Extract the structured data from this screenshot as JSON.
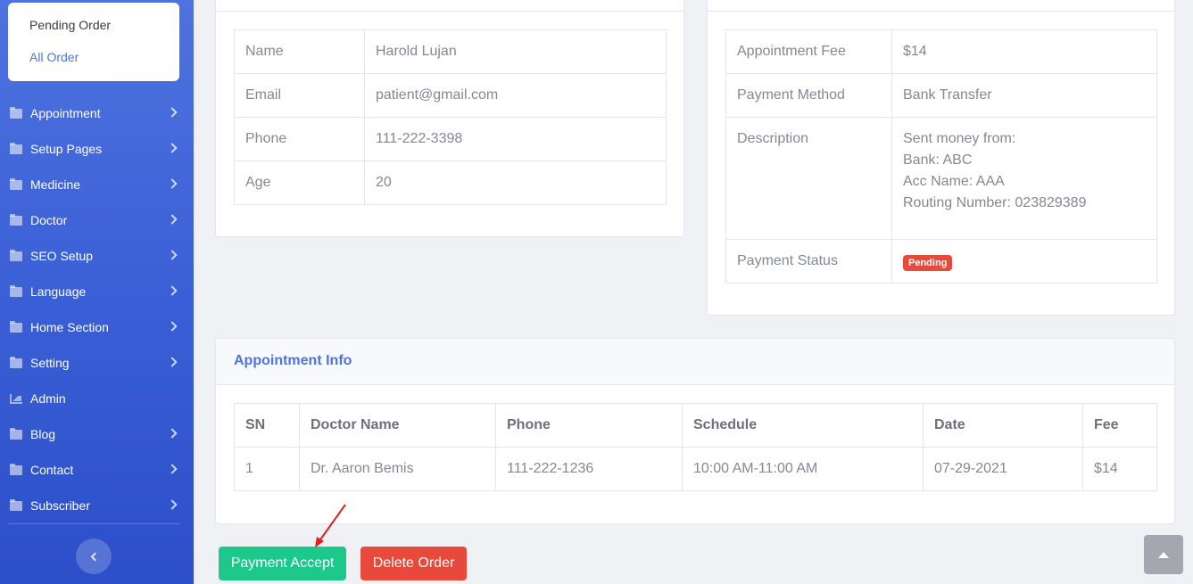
{
  "sidebar": {
    "submenu": [
      "Pending Order",
      "All Order"
    ],
    "items": [
      {
        "label": "Appointment",
        "icon": "folder-icon",
        "chevron": true
      },
      {
        "label": "Setup Pages",
        "icon": "folder-icon",
        "chevron": true
      },
      {
        "label": "Medicine",
        "icon": "folder-icon",
        "chevron": true
      },
      {
        "label": "Doctor",
        "icon": "folder-icon",
        "chevron": true
      },
      {
        "label": "SEO Setup",
        "icon": "folder-icon",
        "chevron": true
      },
      {
        "label": "Language",
        "icon": "folder-icon",
        "chevron": true
      },
      {
        "label": "Home Section",
        "icon": "folder-icon",
        "chevron": true
      },
      {
        "label": "Setting",
        "icon": "folder-icon",
        "chevron": true
      },
      {
        "label": "Admin",
        "icon": "chart-area-icon",
        "chevron": false
      },
      {
        "label": "Blog",
        "icon": "folder-icon",
        "chevron": true
      },
      {
        "label": "Contact",
        "icon": "folder-icon",
        "chevron": true
      },
      {
        "label": "Subscriber",
        "icon": "folder-icon",
        "chevron": true
      }
    ]
  },
  "patient": {
    "rows": [
      {
        "key": "Name",
        "value": "Harold Lujan"
      },
      {
        "key": "Email",
        "value": "patient@gmail.com"
      },
      {
        "key": "Phone",
        "value": "111-222-3398"
      },
      {
        "key": "Age",
        "value": "20"
      }
    ]
  },
  "payment": {
    "fee_label": "Appointment Fee",
    "fee": "$14",
    "method_label": "Payment Method",
    "method": "Bank Transfer",
    "desc_label": "Description",
    "desc_lines": [
      "Sent money from:",
      "Bank: ABC",
      "Acc Name: AAA",
      "Routing Number: 023829389"
    ],
    "status_label": "Payment Status",
    "status": "Pending",
    "status_color": "#e74a3b"
  },
  "appointment": {
    "title": "Appointment Info",
    "headers": [
      "SN",
      "Doctor Name",
      "Phone",
      "Schedule",
      "Date",
      "Fee"
    ],
    "rows": [
      [
        "1",
        "Dr. Aaron Bemis",
        "111-222-1236",
        "10:00 AM-11:00 AM",
        "07-29-2021",
        "$14"
      ]
    ]
  },
  "actions": {
    "accept_label": "Payment Accept",
    "accept_color": "#1cc88a",
    "delete_label": "Delete Order",
    "delete_color": "#e74a3b"
  }
}
